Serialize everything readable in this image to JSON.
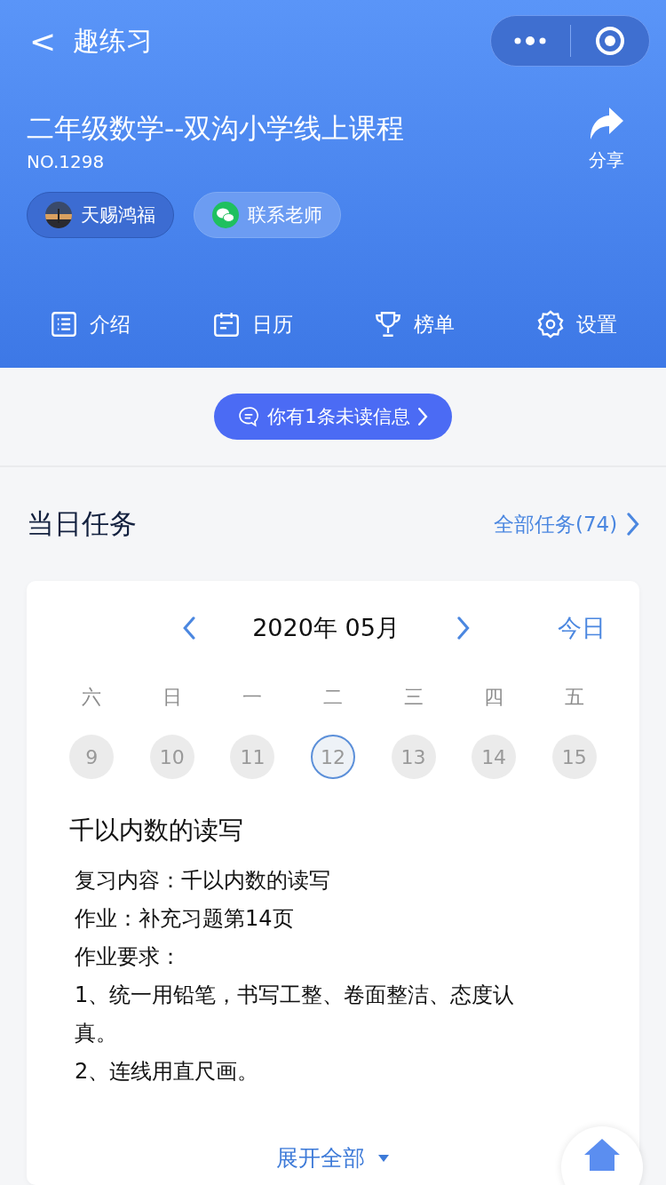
{
  "nav_bar": {
    "back": "<",
    "title": "趣练习"
  },
  "course": {
    "title": "二年级数学--双沟小学线上课程",
    "number": "NO.1298",
    "share_label": "分享"
  },
  "chips": [
    {
      "kind": "avatar",
      "label": "天赐鸿福"
    },
    {
      "kind": "wechat",
      "label": "联系老师"
    }
  ],
  "tabs": [
    {
      "kind": "list",
      "label": "介绍"
    },
    {
      "kind": "calendar",
      "label": "日历"
    },
    {
      "kind": "trophy",
      "label": "榜单"
    },
    {
      "kind": "gear",
      "label": "设置"
    }
  ],
  "notice": {
    "label": "你有1条未读信息"
  },
  "section": {
    "title": "当日任务",
    "link": "全部任务(74)"
  },
  "calendar": {
    "month": "2020年 05月",
    "today": "今日",
    "weekdays": [
      "六",
      "日",
      "一",
      "二",
      "三",
      "四",
      "五"
    ],
    "days": [
      {
        "label": "9",
        "selected": false
      },
      {
        "label": "10",
        "selected": false
      },
      {
        "label": "11",
        "selected": false
      },
      {
        "label": "12",
        "selected": true
      },
      {
        "label": "13",
        "selected": false
      },
      {
        "label": "14",
        "selected": false
      },
      {
        "label": "15",
        "selected": false
      }
    ]
  },
  "task": {
    "title": "千以内数的读写",
    "lines": [
      "复习内容：千以内数的读写",
      "作业：补充习题第14页",
      "作业要求：",
      "1、统一用铅笔，书写工整、卷面整洁、态度认真。",
      "2、连线用直尺画。"
    ],
    "expand": "展开全部"
  }
}
